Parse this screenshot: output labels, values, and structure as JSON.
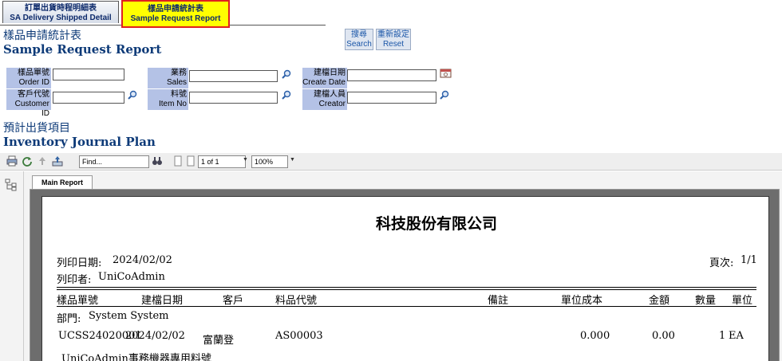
{
  "tabs": [
    {
      "zh": "訂單出貨時程明細表",
      "en": "SA Delivery Shipped Detail"
    },
    {
      "zh": "樣品申請統計表",
      "en": "Sample Request Report"
    }
  ],
  "page_title": {
    "zh": "樣品申請統計表",
    "en": "Sample Request Report"
  },
  "buttons": {
    "search": {
      "zh": "搜尋",
      "en": "Search"
    },
    "reset": {
      "zh": "重新設定",
      "en": "Reset"
    }
  },
  "form": {
    "order_id": {
      "zh": "樣品單號",
      "en": "Order ID",
      "value": ""
    },
    "sales": {
      "zh": "業務",
      "en": "Sales",
      "value": ""
    },
    "create_date": {
      "zh": "建檔日期",
      "en": "Create Date",
      "value": ""
    },
    "customer_id": {
      "zh": "客戶代號",
      "en": "Customer ID",
      "value": ""
    },
    "item_no": {
      "zh": "料號",
      "en": "Item No",
      "value": ""
    },
    "creator": {
      "zh": "建檔人員",
      "en": "Creator",
      "value": ""
    }
  },
  "section_title": {
    "zh": "預計出貨項目",
    "en": "Inventory Journal Plan"
  },
  "viewer": {
    "find_placeholder": "Find...",
    "page_value": "1 of 1",
    "zoom_value": "100%",
    "main_tab": "Main Report"
  },
  "report": {
    "company": "科技股份有限公司",
    "print_date_label": "列印日期:",
    "print_date": "2024/02/02",
    "page_label": "頁次:",
    "page": "1/1",
    "printer_label": "列印者:",
    "printer": "UniCoAdmin",
    "columns": [
      "樣品單號",
      "建檔日期",
      "客戶",
      "料品代號",
      "備註",
      "單位成本",
      "金額",
      "數量",
      "單位"
    ],
    "dept_label": "部門:",
    "dept": "System System",
    "row": {
      "order_id": "UCSS24020001",
      "date": "2024/02/02",
      "customer": "富蘭登",
      "item": "AS00003",
      "unit_cost": "0.000",
      "amount": "0.00",
      "qty": "1",
      "unit": "EA"
    },
    "row_note": "UniCoAdmin事務機器專用料號"
  }
}
